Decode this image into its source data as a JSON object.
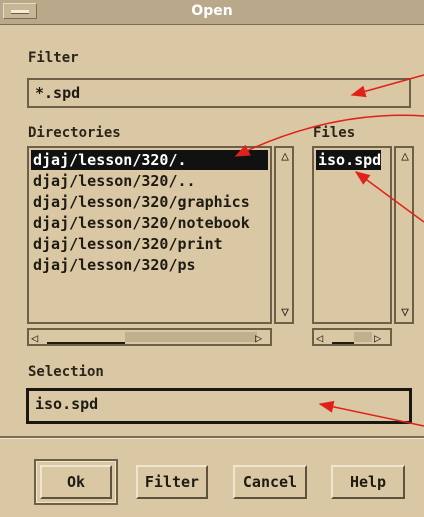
{
  "window": {
    "title": "Open"
  },
  "filter": {
    "label": "Filter",
    "value": "*.spd"
  },
  "directories": {
    "label": "Directories",
    "items": [
      "djaj/lesson/320/.",
      "djaj/lesson/320/..",
      "djaj/lesson/320/graphics",
      "djaj/lesson/320/notebook",
      "djaj/lesson/320/print",
      "djaj/lesson/320/ps"
    ],
    "selected_index": 0
  },
  "files": {
    "label": "Files",
    "items": [
      "iso.spd"
    ],
    "selected_index": 0
  },
  "selection": {
    "label": "Selection",
    "value": "iso.spd"
  },
  "buttons": {
    "ok": "Ok",
    "filter": "Filter",
    "cancel": "Cancel",
    "help": "Help"
  },
  "colors": {
    "dialog_bg": "#d9c8a3",
    "titlebar_bg": "#b9a88a",
    "annotation_arrow": "#e0201b",
    "page_bg": "#f4f8e8"
  }
}
